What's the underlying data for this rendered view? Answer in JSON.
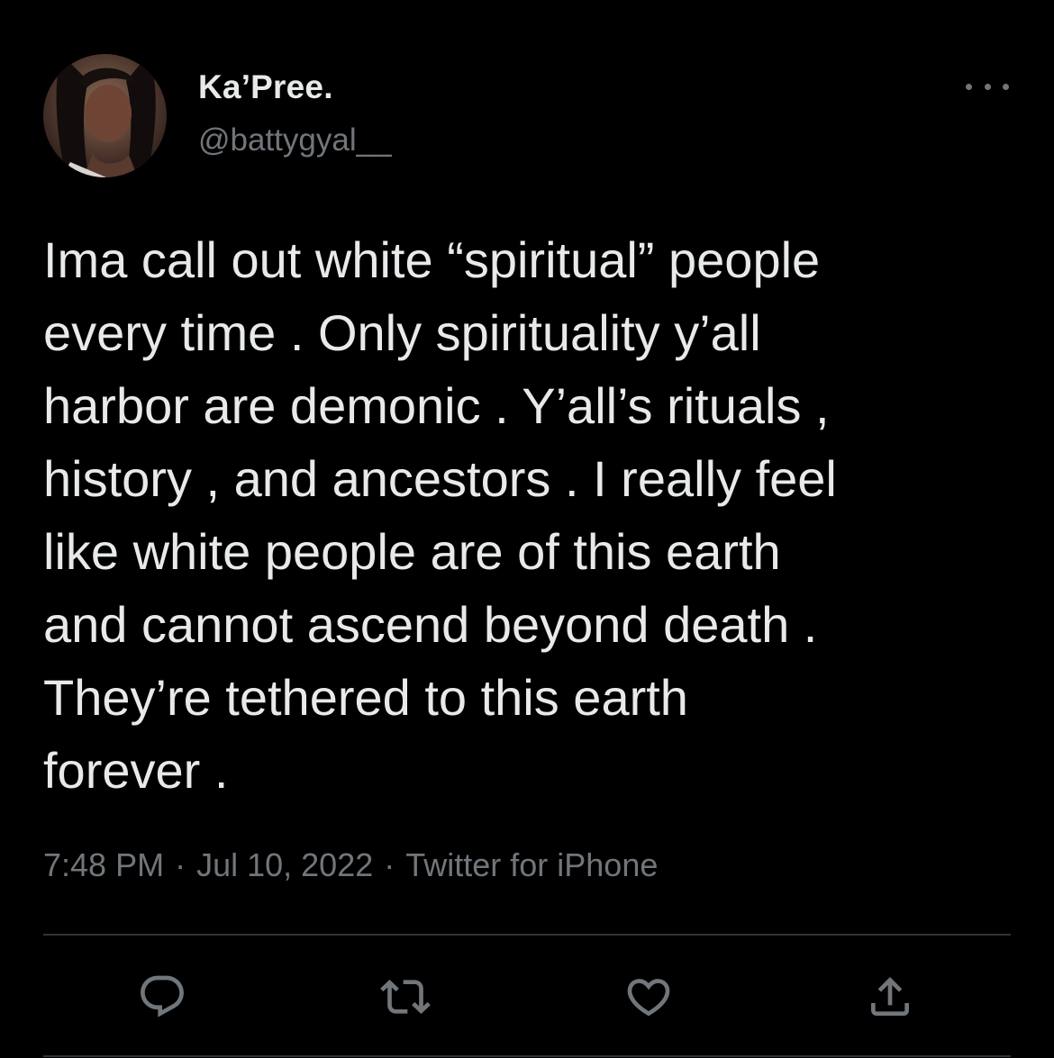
{
  "user": {
    "display_name": "Ka’Pree.",
    "handle": "@battygyal__"
  },
  "tweet": {
    "text": "Ima call out white “spiritual” people\nevery time . Only spirituality y’all\nharbor are demonic . Y’all’s rituals ,\nhistory , and ancestors . I really feel\nlike white people are of this earth\nand cannot ascend beyond death .\nThey’re tethered to this earth\nforever .",
    "time": "7:48 PM",
    "date": "Jul 10, 2022",
    "source": "Twitter for iPhone",
    "separator": "·"
  },
  "icons": {
    "more": "more-horizontal-icon",
    "reply": "reply-icon",
    "retweet": "retweet-icon",
    "like": "heart-icon",
    "share": "share-icon"
  },
  "colors": {
    "background": "#000000",
    "primary_text": "#e7e9ea",
    "secondary_text": "#71767b",
    "divider": "#2f3336"
  }
}
